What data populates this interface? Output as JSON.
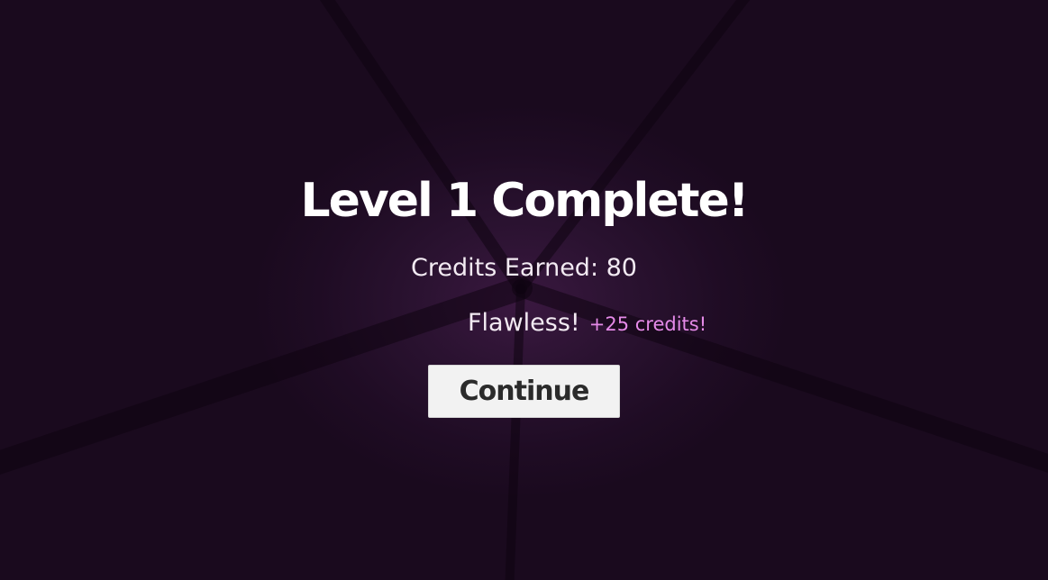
{
  "screen": "level-complete",
  "title": "Level 1 Complete!",
  "credits_line": "Credits Earned: 80",
  "bonus": {
    "label": "Flawless!",
    "amount": "+25 credits!"
  },
  "continue_button": {
    "label": "Continue"
  },
  "colors": {
    "background": "#1c0a1f",
    "center_glow": "#3a1840",
    "title": "#ffffff",
    "bonus_accent": "#e58ae8",
    "button_bg": "#f2f2f2",
    "button_text": "#2b2b2b"
  }
}
